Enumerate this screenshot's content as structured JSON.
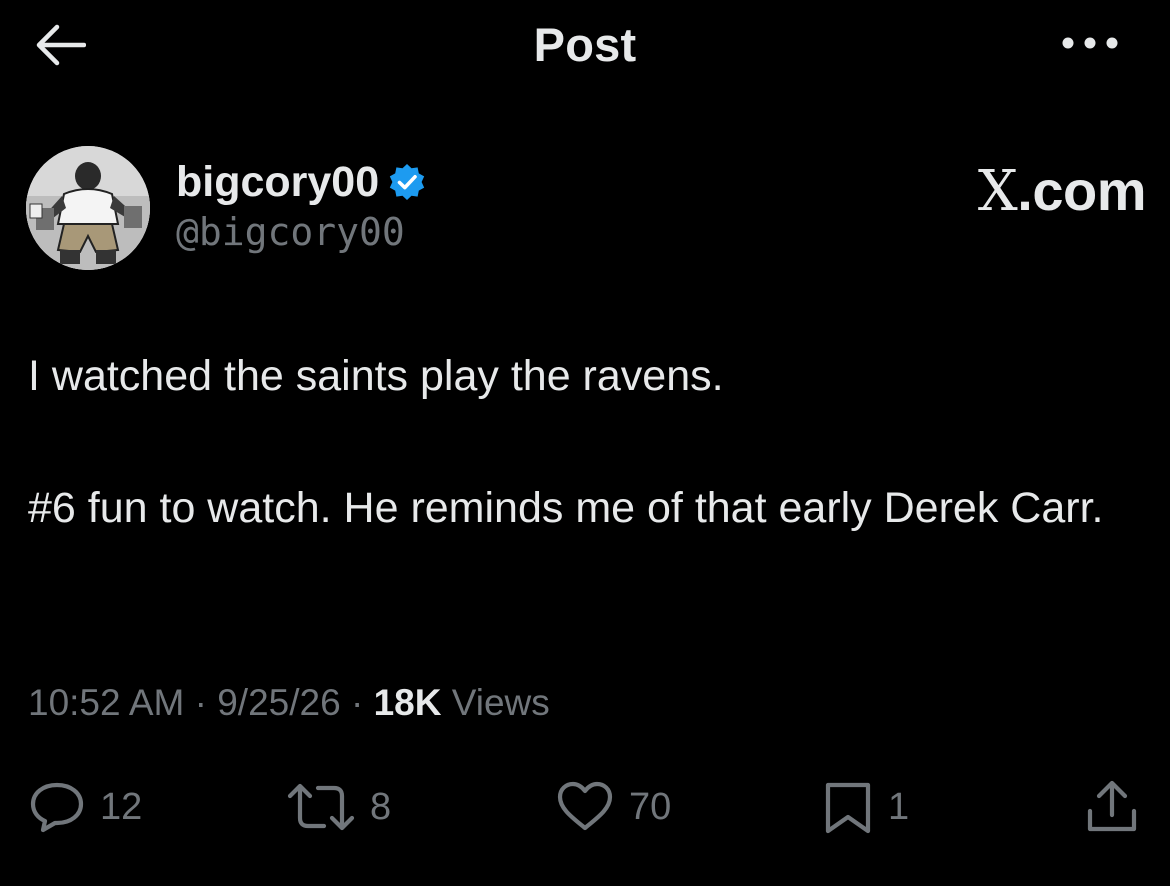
{
  "header": {
    "title": "Post",
    "back_icon": "arrow-left-icon",
    "more_icon": "more-horizontal-icon"
  },
  "author": {
    "display_name": "bigcory00",
    "handle": "@bigcory00",
    "verified_icon": "verified-badge-icon",
    "verified_color": "#1d9bf0"
  },
  "brand": {
    "x_letter": "X",
    "suffix": ".com"
  },
  "post": {
    "paragraphs": [
      "I watched the saints play the ravens.",
      "#6 fun to watch.  He reminds me of that early Derek Carr."
    ]
  },
  "meta": {
    "time": "10:52 AM",
    "separator": "·",
    "date": "9/25/26",
    "views_count": "18K",
    "views_label": "Views"
  },
  "actions": {
    "replies": {
      "icon": "reply-icon",
      "count": "12"
    },
    "reposts": {
      "icon": "repost-icon",
      "count": "8"
    },
    "likes": {
      "icon": "heart-icon",
      "count": "70"
    },
    "bookmarks": {
      "icon": "bookmark-icon",
      "count": "1"
    },
    "share": {
      "icon": "share-icon"
    }
  },
  "colors": {
    "background": "#000000",
    "text_primary": "#e7e9ea",
    "text_secondary": "#71767b",
    "accent": "#1d9bf0"
  }
}
